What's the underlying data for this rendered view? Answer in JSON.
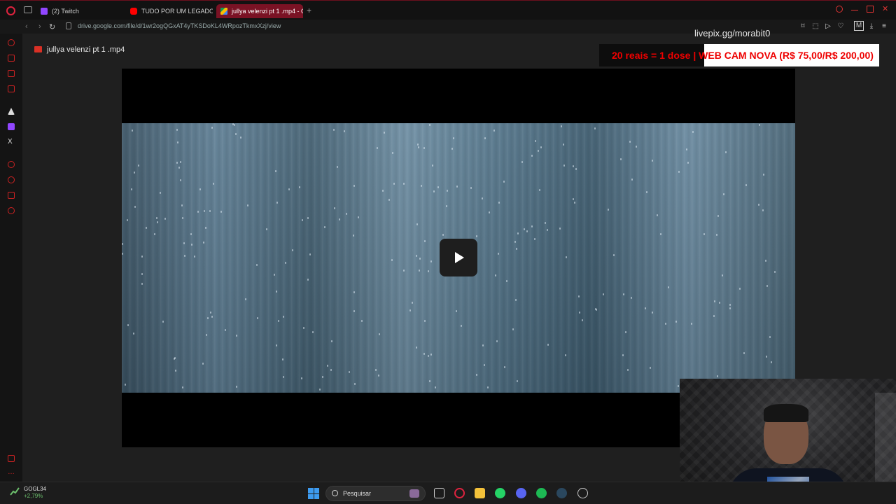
{
  "browser": {
    "tabs": [
      {
        "label": "(2) Twitch",
        "favicon": "twitch-icon",
        "color": "#9146ff"
      },
      {
        "label": "TUDO POR UM LEGADO...",
        "favicon": "youtube-icon",
        "color": "#ff0000"
      },
      {
        "label": "jullya velenzi pt 1 .mp4 - G",
        "favicon": "google-drive-icon",
        "color": "#fbbc04",
        "active": true
      }
    ],
    "url": "drive.google.com/file/d/1wr2ogQGxAT4yTKSDoKL4WRpozTkmxXzj/view",
    "accent": "#7a1224"
  },
  "drive": {
    "file_title": "jullya velenzi pt 1 .mp4",
    "play_label": "play"
  },
  "stream_overlay": {
    "livepix": "livepix.gg/morabit0",
    "ticker": "20 reais = 1 dose | WEB CAM NOVA (R$ 75,00/R$ 200,00)",
    "ticker_color": "#e00000"
  },
  "taskbar": {
    "stock_name": "GOGL34",
    "stock_change": "+2,79%",
    "search_placeholder": "Pesquisar",
    "apps": [
      "widgets-icon",
      "file-explorer-icon",
      "opera-icon",
      "folder-icon",
      "whatsapp-icon",
      "discord-icon",
      "spotify-icon",
      "steam-icon",
      "obs-icon"
    ]
  }
}
